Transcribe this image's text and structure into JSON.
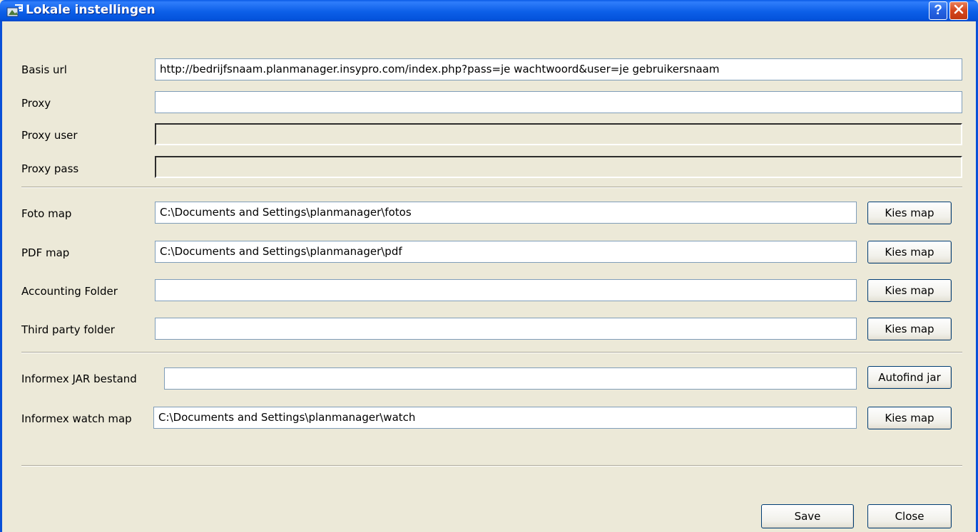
{
  "window": {
    "title": "Lokale instellingen",
    "help_label": "?"
  },
  "fields": {
    "basis_url": {
      "label": "Basis url",
      "value": "http://bedrijfsnaam.planmanager.insypro.com/index.php?pass=je wachtwoord&user=je gebruikersnaam"
    },
    "proxy": {
      "label": "Proxy",
      "value": ""
    },
    "proxy_user": {
      "label": "Proxy user",
      "value": ""
    },
    "proxy_pass": {
      "label": "Proxy pass",
      "value": ""
    },
    "foto_map": {
      "label": "Foto map",
      "value": "C:\\Documents and Settings\\planmanager\\fotos",
      "button": "Kies map"
    },
    "pdf_map": {
      "label": "PDF map",
      "value": "C:\\Documents and Settings\\planmanager\\pdf",
      "button": "Kies map"
    },
    "accounting_folder": {
      "label": "Accounting Folder",
      "value": "",
      "button": "Kies map"
    },
    "third_party_folder": {
      "label": "Third party folder",
      "value": "",
      "button": "Kies map"
    },
    "informex_jar": {
      "label": "Informex JAR bestand",
      "value": "",
      "button": "Autofind jar"
    },
    "informex_watch": {
      "label": "Informex watch map",
      "value": "C:\\Documents and Settings\\planmanager\\watch",
      "button": "Kies map"
    }
  },
  "footer": {
    "save_label": "Save",
    "close_label": "Close"
  }
}
